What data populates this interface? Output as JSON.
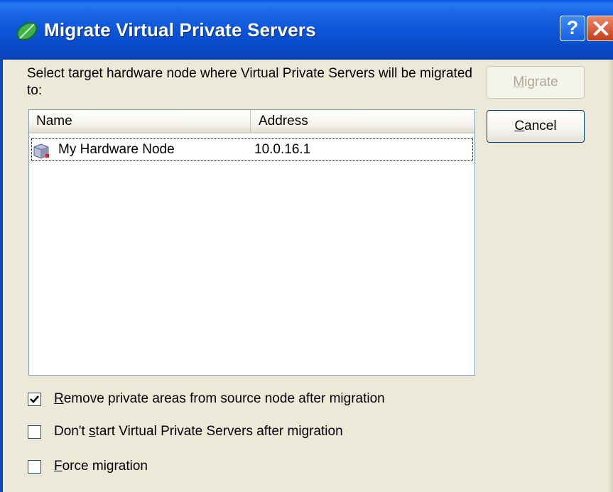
{
  "window": {
    "title": "Migrate Virtual Private Servers",
    "help_glyph": "?",
    "icons": {
      "app": "leaf-logo-icon",
      "help": "help-icon",
      "close": "close-icon"
    }
  },
  "instruction": "Select target hardware node where Virtual Private Servers will be migrated to:",
  "buttons": {
    "migrate": {
      "pre": "",
      "accel": "M",
      "post": "igrate",
      "enabled": false
    },
    "cancel": {
      "pre": "",
      "accel": "C",
      "post": "ancel",
      "enabled": true
    }
  },
  "list": {
    "columns": [
      "Name",
      "Address"
    ],
    "rows": [
      {
        "icon": "hardware-node-icon",
        "name": "My Hardware Node",
        "address": "10.0.16.1"
      }
    ]
  },
  "options": [
    {
      "checked": true,
      "pre": "",
      "accel": "R",
      "post": "emove private areas from source node after migration"
    },
    {
      "checked": false,
      "pre": "Don't ",
      "accel": "s",
      "post": "tart Virtual Private Servers after migration"
    },
    {
      "checked": false,
      "pre": "",
      "accel": "F",
      "post": "orce migration"
    }
  ],
  "colors": {
    "titlebar": "#0a48c4",
    "dialog_bg": "#ece9d8",
    "disabled_text": "#aca899"
  }
}
